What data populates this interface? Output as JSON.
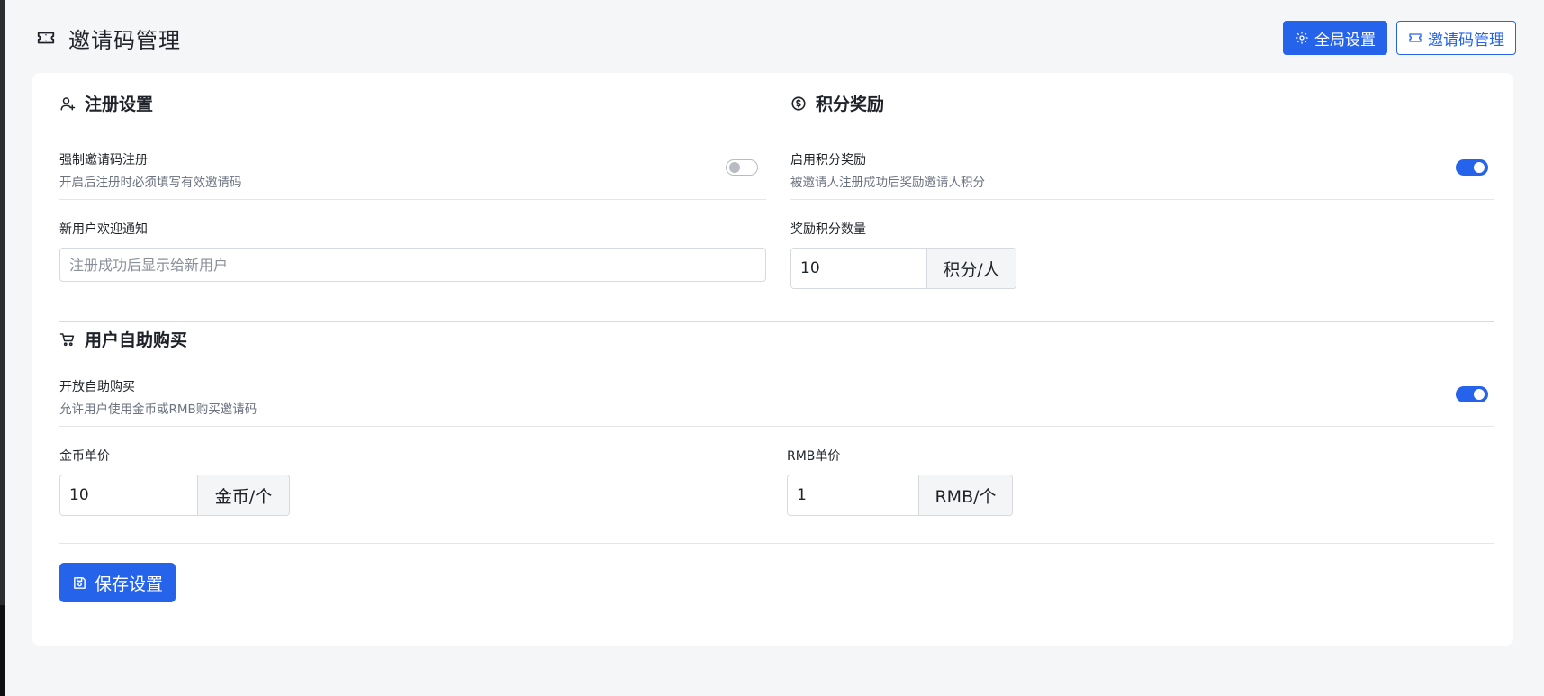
{
  "header": {
    "title": "邀请码管理",
    "icon": "ticket-icon",
    "global_settings_label": "全局设置",
    "invite_manage_label": "邀请码管理"
  },
  "registration": {
    "title": "注册设置",
    "icon": "user-plus-icon",
    "force_invite": {
      "label": "强制邀请码注册",
      "desc": "开启后注册时必须填写有效邀请码",
      "enabled": false
    },
    "welcome": {
      "label": "新用户欢迎通知",
      "placeholder": "注册成功后显示给新用户",
      "value": ""
    }
  },
  "points": {
    "title": "积分奖励",
    "icon": "coin-icon",
    "enable": {
      "label": "启用积分奖励",
      "desc": "被邀请人注册成功后奖励邀请人积分",
      "enabled": true
    },
    "amount": {
      "label": "奖励积分数量",
      "value": "10",
      "unit": "积分/人"
    }
  },
  "purchase": {
    "title": "用户自助购买",
    "icon": "cart-icon",
    "enable": {
      "label": "开放自助购买",
      "desc": "允许用户使用金币或RMB购买邀请码",
      "enabled": true
    },
    "gold_price": {
      "label": "金币单价",
      "value": "10",
      "unit": "金币/个"
    },
    "rmb_price": {
      "label": "RMB单价",
      "value": "1",
      "unit": "RMB/个"
    }
  },
  "save_label": "保存设置",
  "colors": {
    "primary": "#2563eb",
    "background": "#f5f6f8",
    "card": "#ffffff"
  }
}
